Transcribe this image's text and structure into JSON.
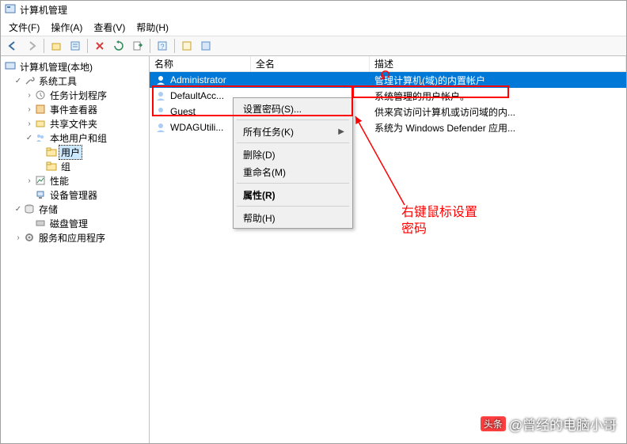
{
  "window": {
    "title": "计算机管理"
  },
  "menubar": {
    "file": "文件(F)",
    "action": "操作(A)",
    "view": "查看(V)",
    "help": "帮助(H)"
  },
  "tree": {
    "root": "计算机管理(本地)",
    "sys_tools": "系统工具",
    "task_scheduler": "任务计划程序",
    "event_viewer": "事件查看器",
    "shared_folders": "共享文件夹",
    "local_users": "本地用户和组",
    "users": "用户",
    "groups": "组",
    "performance": "性能",
    "device_mgr": "设备管理器",
    "storage": "存储",
    "disk_mgmt": "磁盘管理",
    "services_apps": "服务和应用程序"
  },
  "list": {
    "col_name": "名称",
    "col_fullname": "全名",
    "col_desc": "描述",
    "rows": [
      {
        "name": "Administrator",
        "full": "",
        "desc": "管理计算机(域)的内置帐户"
      },
      {
        "name": "DefaultAcc...",
        "full": "",
        "desc": "系统管理的用户帐户。"
      },
      {
        "name": "Guest",
        "full": "",
        "desc": "供来宾访问计算机或访问域的内..."
      },
      {
        "name": "WDAGUtili...",
        "full": "",
        "desc": "系统为 Windows Defender 应用..."
      }
    ]
  },
  "ctx": {
    "set_password": "设置密码(S)...",
    "all_tasks": "所有任务(K)",
    "delete": "删除(D)",
    "rename": "重命名(M)",
    "properties": "属性(R)",
    "help": "帮助(H)"
  },
  "annotation": {
    "text_l1": "右键鼠标设置",
    "text_l2": "密码"
  },
  "watermark": {
    "badge": "头条",
    "text": "@曾经的电脑小哥"
  }
}
